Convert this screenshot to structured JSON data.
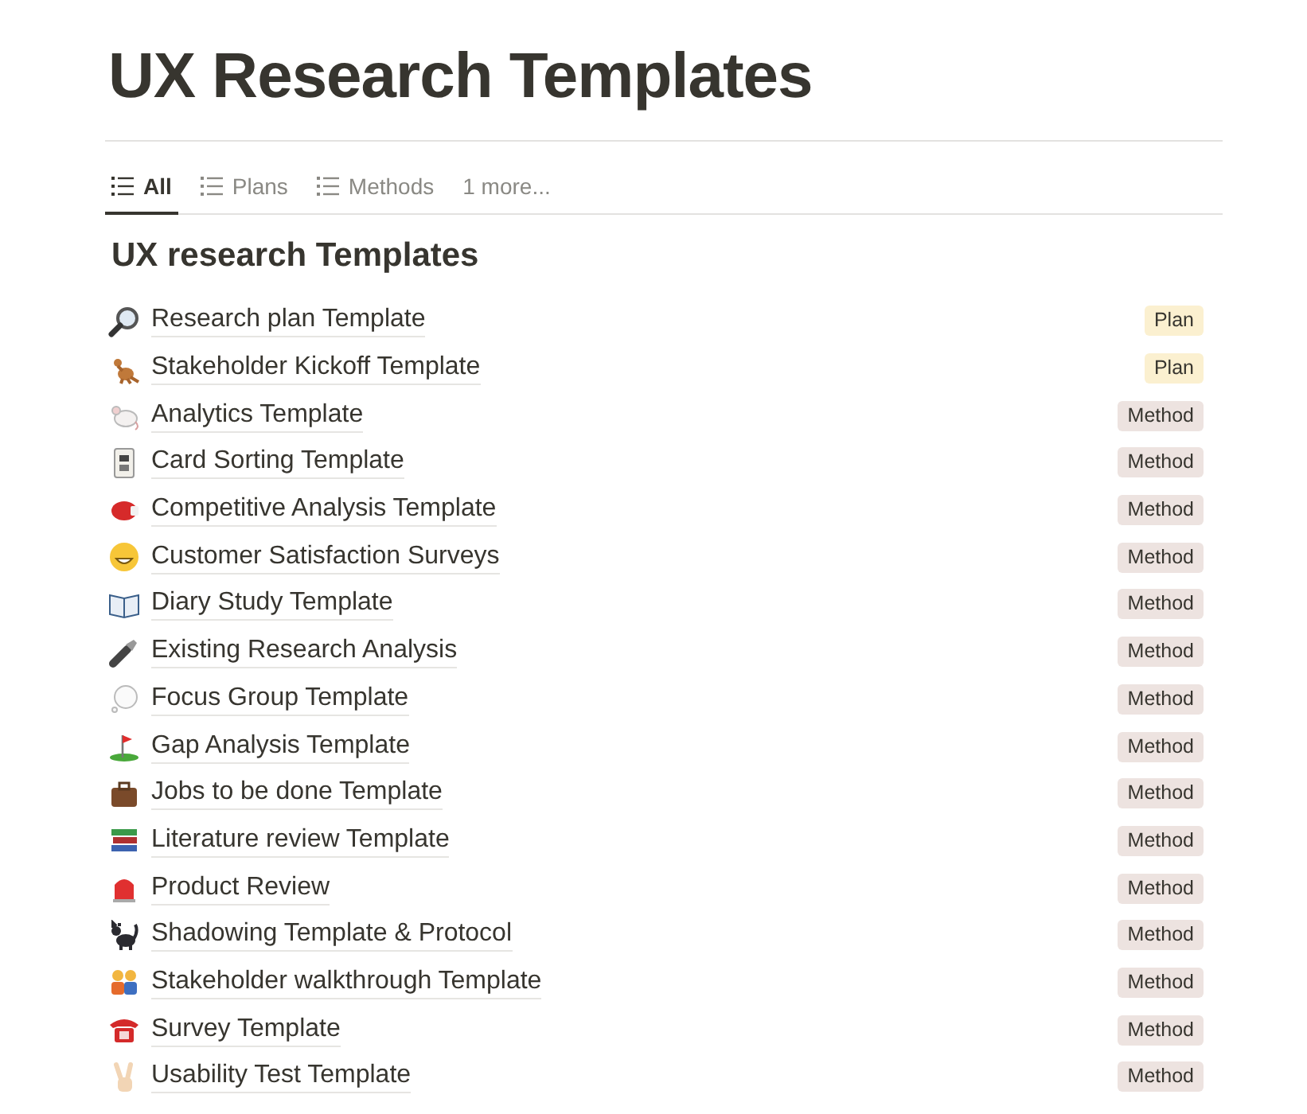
{
  "page": {
    "title": "UX Research Templates"
  },
  "tabs": [
    {
      "label": "All",
      "selected": true,
      "kind": "view"
    },
    {
      "label": "Plans",
      "selected": false,
      "kind": "view"
    },
    {
      "label": "Methods",
      "selected": false,
      "kind": "view"
    },
    {
      "label": "1 more...",
      "selected": false,
      "kind": "more"
    }
  ],
  "section": {
    "heading": "UX research Templates"
  },
  "items": [
    {
      "title": "Research plan Template",
      "tag": {
        "label": "Plan",
        "color": "#fbf0d0"
      }
    },
    {
      "title": "Stakeholder Kickoff Template",
      "tag": {
        "label": "Plan",
        "color": "#fbf0d0"
      }
    },
    {
      "title": "Analytics Template",
      "tag": {
        "label": "Method",
        "color": "#ede3e0"
      }
    },
    {
      "title": "Card Sorting Template",
      "tag": {
        "label": "Method",
        "color": "#ede3e0"
      }
    },
    {
      "title": "Competitive Analysis Template",
      "tag": {
        "label": "Method",
        "color": "#ede3e0"
      }
    },
    {
      "title": "Customer Satisfaction Surveys",
      "tag": {
        "label": "Method",
        "color": "#ede3e0"
      }
    },
    {
      "title": "Diary Study Template",
      "tag": {
        "label": "Method",
        "color": "#ede3e0"
      }
    },
    {
      "title": "Existing Research Analysis",
      "tag": {
        "label": "Method",
        "color": "#ede3e0"
      }
    },
    {
      "title": "Focus Group Template",
      "tag": {
        "label": "Method",
        "color": "#ede3e0"
      }
    },
    {
      "title": "Gap Analysis Template",
      "tag": {
        "label": "Method",
        "color": "#ede3e0"
      }
    },
    {
      "title": "Jobs to be done Template",
      "tag": {
        "label": "Method",
        "color": "#ede3e0"
      }
    },
    {
      "title": "Literature review Template",
      "tag": {
        "label": "Method",
        "color": "#ede3e0"
      }
    },
    {
      "title": "Product Review",
      "tag": {
        "label": "Method",
        "color": "#ede3e0"
      }
    },
    {
      "title": "Shadowing Template & Protocol",
      "tag": {
        "label": "Method",
        "color": "#ede3e0"
      }
    },
    {
      "title": "Stakeholder walkthrough Template",
      "tag": {
        "label": "Method",
        "color": "#ede3e0"
      }
    },
    {
      "title": "Survey Template",
      "tag": {
        "label": "Method",
        "color": "#ede3e0"
      }
    },
    {
      "title": "Usability Test Template",
      "tag": {
        "label": "Method",
        "color": "#ede3e0"
      }
    }
  ]
}
